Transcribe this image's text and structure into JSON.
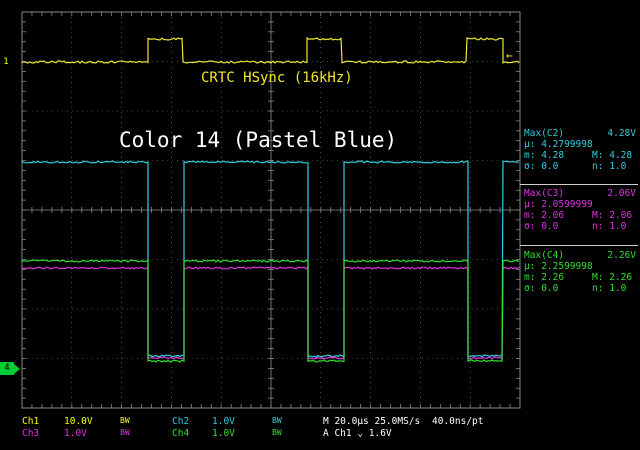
{
  "annotations": {
    "hsync_label": "CRTC HSync (16kHz)",
    "color_label": "Color 14 (Pastel Blue)"
  },
  "markers": {
    "ch1": "1",
    "ch4": "4"
  },
  "measurements": [
    {
      "title": "Max(C2)",
      "value": "4.28V",
      "mu_label": "µ:",
      "mu": "4.2799998",
      "min_label": "m:",
      "min": "4.28",
      "max_label": "M:",
      "max": "4.28",
      "sigma_label": "σ:",
      "sigma": "0.0",
      "n_label": "n:",
      "n": "1.0",
      "color": "#33ccdd"
    },
    {
      "title": "Max(C3)",
      "value": "2.06V",
      "mu_label": "µ:",
      "mu": "2.0599999",
      "min_label": "m:",
      "min": "2.06",
      "max_label": "M:",
      "max": "2.06",
      "sigma_label": "σ:",
      "sigma": "0.0",
      "n_label": "n:",
      "n": "1.0",
      "color": "#dd33dd"
    },
    {
      "title": "Max(C4)",
      "value": "2.26V",
      "mu_label": "µ:",
      "mu": "2.2599998",
      "min_label": "m:",
      "min": "2.26",
      "max_label": "M:",
      "max": "2.26",
      "sigma_label": "σ:",
      "sigma": "0.0",
      "n_label": "n:",
      "n": "1.0",
      "color": "#33dd33"
    }
  ],
  "footer": {
    "ch1": {
      "label": "Ch1",
      "scale": "10.0V",
      "bw": "BW",
      "color": "#ffff00"
    },
    "ch2": {
      "label": "Ch2",
      "scale": "1.0V",
      "bw": "BW",
      "color": "#33ccdd"
    },
    "ch3": {
      "label": "Ch3",
      "scale": "1.0V",
      "bw": "BW",
      "color": "#dd33dd"
    },
    "ch4": {
      "label": "Ch4",
      "scale": "1.0V",
      "bw": "BW",
      "color": "#33dd33"
    },
    "timebase": "M 20.0µs 25.0MS/s",
    "resolution": "40.0ns/pt",
    "trigger": "A  Ch1  ⌄  1.6V"
  },
  "colors": {
    "ch1": "#f0e830",
    "ch2": "#30d0e0",
    "ch3": "#e030e0",
    "ch4": "#30e030",
    "grid": "#888888"
  }
}
